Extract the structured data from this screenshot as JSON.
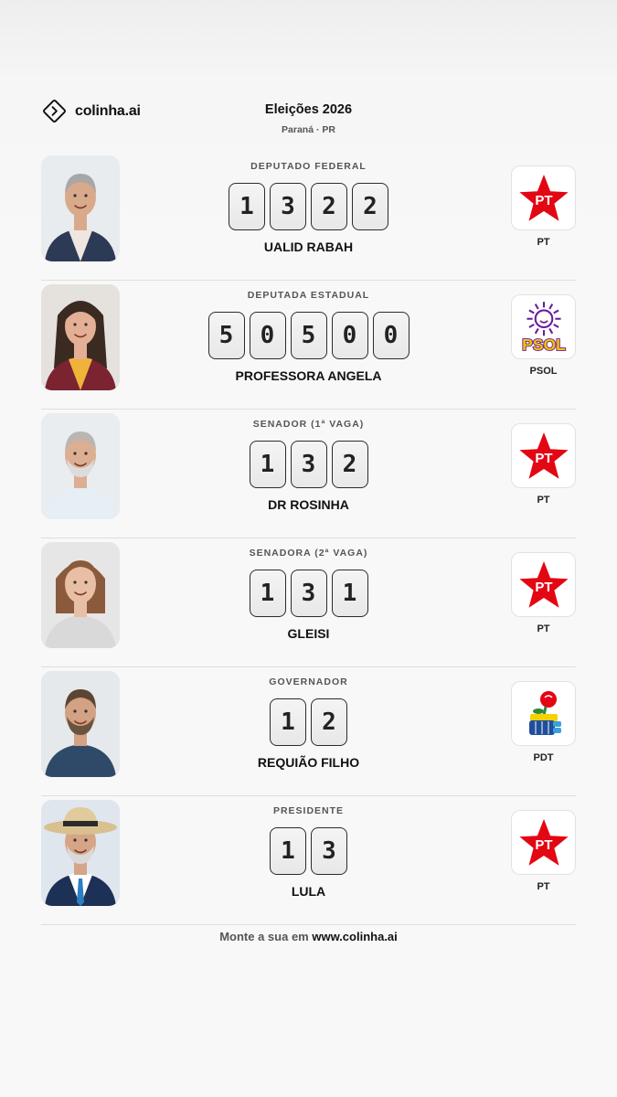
{
  "brand": {
    "name": "colinha.ai",
    "logo_icon": "diamond-chevron-icon"
  },
  "header": {
    "title": "Eleições 2026",
    "subtitle": "Paraná · PR"
  },
  "candidates": [
    {
      "office": "DEPUTADO FEDERAL",
      "digits": [
        "1",
        "3",
        "2",
        "2"
      ],
      "name": "UALID RABAH",
      "party": "PT",
      "party_logo": "pt-star-icon"
    },
    {
      "office": "DEPUTADA ESTADUAL",
      "digits": [
        "5",
        "0",
        "5",
        "0",
        "0"
      ],
      "name": "PROFESSORA ANGELA",
      "party": "PSOL",
      "party_logo": "psol-sun-icon"
    },
    {
      "office": "SENADOR (1ª VAGA)",
      "digits": [
        "1",
        "3",
        "2"
      ],
      "name": "DR ROSINHA",
      "party": "PT",
      "party_logo": "pt-star-icon"
    },
    {
      "office": "SENADORA (2ª VAGA)",
      "digits": [
        "1",
        "3",
        "1"
      ],
      "name": "GLEISI",
      "party": "PT",
      "party_logo": "pt-star-icon"
    },
    {
      "office": "GOVERNADOR",
      "digits": [
        "1",
        "2"
      ],
      "name": "REQUIÃO FILHO",
      "party": "PDT",
      "party_logo": "pdt-fist-rose-icon"
    },
    {
      "office": "PRESIDENTE",
      "digits": [
        "1",
        "3"
      ],
      "name": "LULA",
      "party": "PT",
      "party_logo": "pt-star-icon"
    }
  ],
  "footer": {
    "prefix": "Monte a sua em ",
    "link": "www.colinha.ai"
  },
  "colors": {
    "pt_red": "#e30613",
    "psol_purple": "#6a1b9a",
    "psol_yellow": "#f5c400",
    "pdt_blue": "#1f4e9c"
  }
}
